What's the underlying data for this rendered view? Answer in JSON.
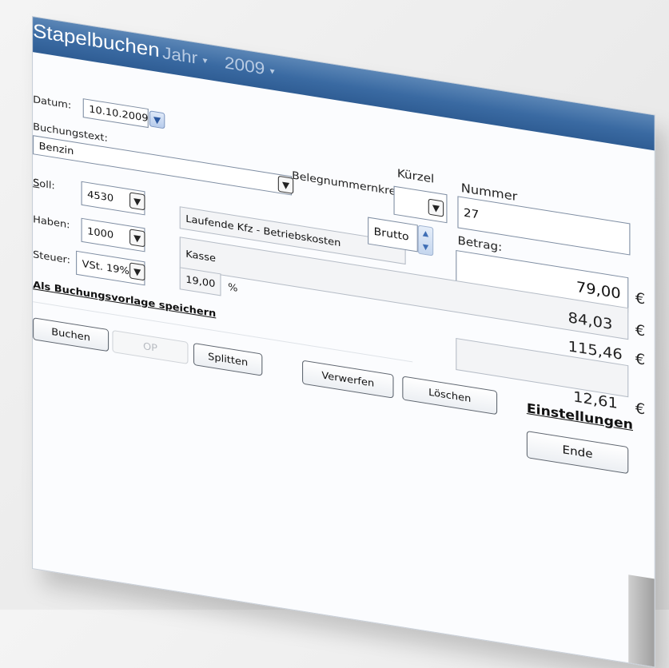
{
  "window": {
    "title": "Stapelbuchen",
    "year_label": "Jahr",
    "year_value": "2009"
  },
  "form": {
    "datum_label": "Datum:",
    "datum_value": "10.10.2009",
    "buchungstext_label": "Buchungstext:",
    "buchungstext_value": "Benzin",
    "belegnummernkreis_label": "Belegnummernkreis:",
    "kuerzel_label": "Kürzel",
    "kuerzel_value": "",
    "nummer_label": "Nummer",
    "nummer_value": "27",
    "soll_label": "Soll:",
    "soll_value": "4530",
    "soll_desc": "Laufende Kfz - Betriebskosten",
    "haben_label": "Haben:",
    "haben_value": "1000",
    "haben_desc": "Kasse",
    "steuer_label": "Steuer:",
    "steuer_value": "VSt. 19%",
    "steuer_rate": "19,00",
    "percent_sign": "%",
    "brutto_label": "Brutto",
    "betrag_label": "Betrag:",
    "betrag_value": "79,00",
    "amount_1": "84,03",
    "amount_2": "115,46",
    "amount_3": "12,61",
    "currency": "€"
  },
  "links": {
    "save_template": "Als Buchungsvorlage speichern",
    "settings": "Einstellungen"
  },
  "buttons": {
    "buchen": "Buchen",
    "op": "OP",
    "splitten": "Splitten",
    "verwerfen": "Verwerfen",
    "loeschen": "Löschen",
    "ende": "Ende"
  },
  "icons": {
    "dropdown": "chevron-down-icon",
    "spinner": "up-down-spinner-icon"
  },
  "colors": {
    "titlebar": "#3a6aa2",
    "title_text": "#ffffff",
    "year_text": "#b8cbe3"
  }
}
